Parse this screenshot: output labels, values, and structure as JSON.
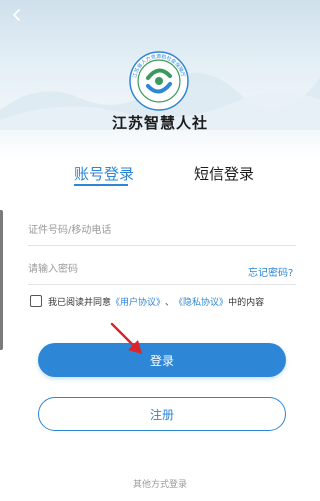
{
  "app": {
    "name": "江苏智慧人社",
    "logo_text": "江苏省人力资源和社会保障厅"
  },
  "tabs": [
    {
      "label": "账号登录",
      "active": true
    },
    {
      "label": "短信登录",
      "active": false
    }
  ],
  "form": {
    "id_placeholder": "证件号码/移动电话",
    "password_placeholder": "请输入密码",
    "forgot_label": "忘记密码?"
  },
  "agreement": {
    "prefix": "我已阅读并同意",
    "user_link": "《用户协议》",
    "separator": "、",
    "privacy_link": "《隐私协议》",
    "suffix": "中的内容",
    "checked": false
  },
  "buttons": {
    "login": "登录",
    "register": "注册"
  },
  "footer": {
    "other_methods": "其他方式登录"
  },
  "colors": {
    "accent": "#2e86d6",
    "logo_green": "#3a9a5c",
    "arrow": "#d9262c"
  },
  "icons": {
    "back": "chevron-left-icon",
    "annotation": "red-arrow-icon"
  }
}
